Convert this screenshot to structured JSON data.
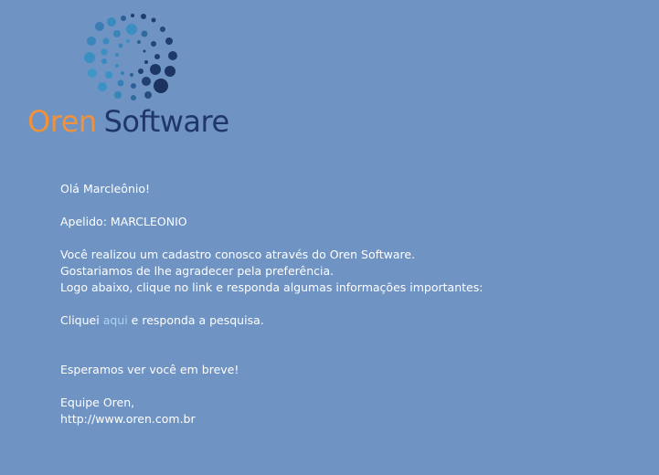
{
  "logo": {
    "name_part1": "Oren",
    "name_part2": "Software"
  },
  "message": {
    "greeting": "Olá Marcleônio!",
    "nickname_label": "Apelido:",
    "nickname_value": "MARCLEONIO",
    "line1": "Você realizou um cadastro conosco através do Oren Software.",
    "line2": "Gostariamos de lhe agradecer pela preferência.",
    "line3": "Logo abaixo, clique no link e responda algumas informações importantes:",
    "cta_prefix": "Cliquei",
    "cta_link": "aqui",
    "cta_suffix": "e responda a pesquisa.",
    "closing": "Esperamos ver você em breve!",
    "signature_team": "Equipe Oren,",
    "signature_url": "http://www.oren.com.br"
  },
  "colors": {
    "background": "#6f93c3",
    "text": "#ffffff",
    "link": "#a9d6f4",
    "brand_orange": "#f0923c",
    "brand_navy": "#1f3768"
  }
}
